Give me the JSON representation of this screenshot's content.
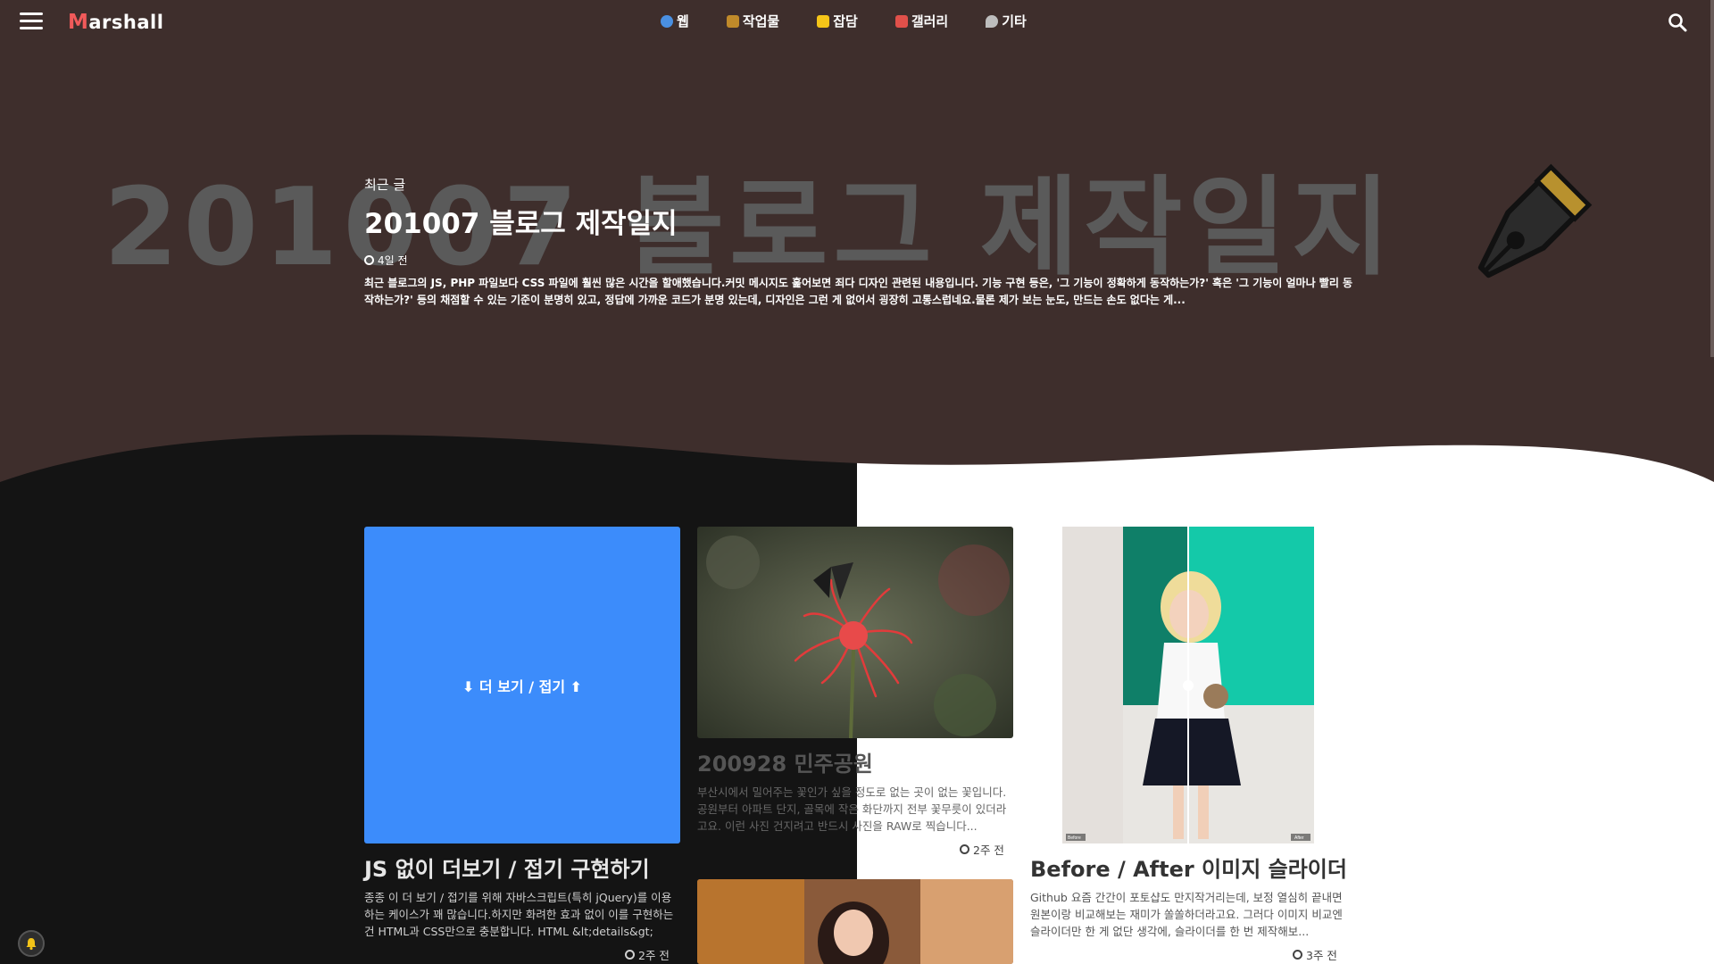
{
  "nav": {
    "logo_first": "M",
    "logo_rest": "arshall",
    "items": [
      {
        "label": "웹",
        "icon": "globe-icon",
        "color": "#4a90e2"
      },
      {
        "label": "작업물",
        "icon": "briefcase-icon",
        "color": "#c08a2a"
      },
      {
        "label": "잡담",
        "icon": "note-icon",
        "color": "#f5c518"
      },
      {
        "label": "갤러리",
        "icon": "image-icon",
        "color": "#e0504a"
      },
      {
        "label": "기타",
        "icon": "chat-icon",
        "color": "#bdbdbd"
      }
    ]
  },
  "hero": {
    "big_title": "201007 블로그 제작일지",
    "label": "최근 글",
    "title": "201007 블로그 제작일지",
    "time": "4일 전",
    "desc": "최근 블로그의 JS, PHP 파일보다 CSS 파일에 훨씬 많은 시간을 할애했습니다.커밋 메시지도 훑어보면 죄다 디자인 관련된 내용입니다. 기능 구현 등은, '그 기능이 정확하게 동작하는가?' 혹은 '그 기능이 얼마나 빨리 동작하는가?' 등의 채점할 수 있는 기준이 분명히 있고, 정답에 가까운 코드가 분명 있는데, 디자인은 그런 게 없어서 굉장히 고통스럽네요.물론 제가 보는 눈도, 만드는 손도 없다는 게..."
  },
  "cards": [
    {
      "thumb_text": "⬇ 더 보기 / 접기 ⬆",
      "title": "JS 없이 더보기 / 접기 구현하기",
      "desc": "종종 이 더 보기 / 접기를 위해 자바스크립트(특히 jQuery)를 이용하는 케이스가 꽤 많습니다.하지만 화려한 효과 없이 이를 구현하는 건 HTML과 CSS만으로 충분합니다. HTML &lt;details&gt;",
      "time": "2주 전"
    },
    {
      "title": "200928 민주공원",
      "desc": "부산시에서 밀어주는 꽃인가 싶을 정도로 없는 곳이 없는 꽃입니다. 공원부터 아파트 단지, 골목에 작은 화단까지 전부 꽃무릇이 있더라고요. 이런 사진 건지려고 반드시 사진을 RAW로 찍습니다...",
      "time": "2주 전"
    },
    {
      "label_before": "Before",
      "label_after": "After",
      "title": "Before / After 이미지 슬라이더",
      "desc": "Github 요즘 간간이 포토샵도 만지작거리는데, 보정 열심히 끝내면 원본이랑 비교해보는 재미가 쏠쏠하더라고요. 그러다 이미지 비교엔 슬라이더만 한 게 없단 생각에, 슬라이더를 한 번 제작해보...",
      "time": "3주 전"
    }
  ],
  "colors": {
    "hero_bg": "#3e2e2c",
    "dark_wave": "#141414",
    "accent_blue": "#3c8cfb"
  }
}
